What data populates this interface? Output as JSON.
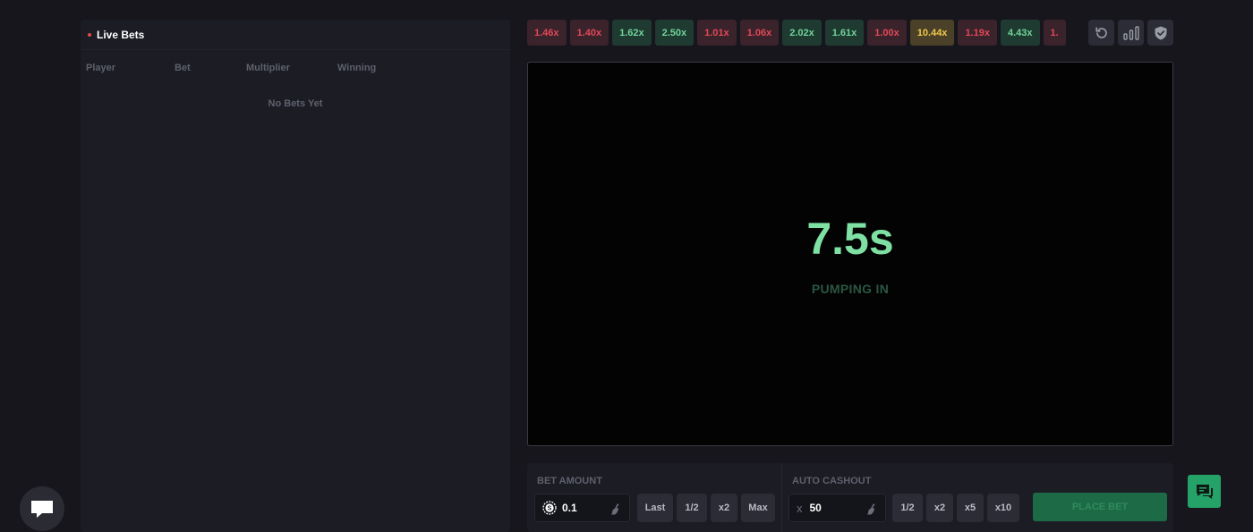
{
  "live_bets": {
    "title": "Live Bets",
    "columns": [
      "Player",
      "Bet",
      "Multiplier",
      "Winning"
    ],
    "empty_text": "No Bets Yet"
  },
  "history": [
    {
      "label": "1.46x",
      "color": "red"
    },
    {
      "label": "1.40x",
      "color": "red"
    },
    {
      "label": "1.62x",
      "color": "green"
    },
    {
      "label": "2.50x",
      "color": "green"
    },
    {
      "label": "1.01x",
      "color": "red"
    },
    {
      "label": "1.06x",
      "color": "red"
    },
    {
      "label": "2.02x",
      "color": "green"
    },
    {
      "label": "1.61x",
      "color": "green"
    },
    {
      "label": "1.00x",
      "color": "red"
    },
    {
      "label": "10.44x",
      "color": "gold"
    },
    {
      "label": "1.19x",
      "color": "red"
    },
    {
      "label": "4.43x",
      "color": "green"
    },
    {
      "label": "1.",
      "color": "red"
    }
  ],
  "toolbar_icons": [
    "refresh-icon",
    "bar-chart-icon",
    "shield-check-icon"
  ],
  "game": {
    "countdown": "7.5s",
    "status": "PUMPING IN"
  },
  "controls": {
    "bet_amount_label": "BET AMOUNT",
    "bet_amount_value": "0.1",
    "bet_buttons": [
      "Last",
      "1/2",
      "x2",
      "Max"
    ],
    "auto_cashout_label": "AUTO CASHOUT",
    "auto_cashout_prefix": "x",
    "auto_cashout_value": "50",
    "cashout_buttons": [
      "1/2",
      "x2",
      "x5",
      "x10"
    ],
    "place_bet_label": "PLACE BET"
  },
  "colors": {
    "accent_green": "#7fe0a3",
    "loss_red": "#e2485a",
    "gold": "#f0c84a",
    "place_bet": "#1d6b46"
  }
}
